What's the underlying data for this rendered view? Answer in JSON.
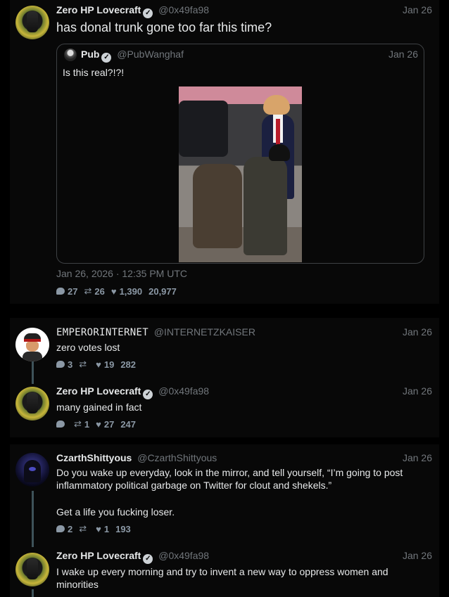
{
  "colors": {
    "background": "#000000",
    "card": "#080808",
    "text": "#e7e9ea",
    "muted": "#71767b",
    "thread_line": "#3e5259"
  },
  "main_tweet": {
    "author_name": "Zero HP Lovecraft",
    "handle": "@0x49fa98",
    "date": "Jan 26",
    "text": "has donal trunk gone too far this time?",
    "quote": {
      "author_name": "Pub",
      "handle": "@PubWanghaf",
      "date": "Jan 26",
      "text": "Is this real?!?!"
    },
    "timestamp": "Jan 26, 2026 · 12:35 PM UTC",
    "stats": {
      "replies": "27",
      "retweets": "26",
      "likes": "1,390",
      "views": "20,977"
    }
  },
  "replies": [
    {
      "author_name": "EMPERORINTERNET",
      "handle": "@INTERNETZKAISER",
      "date": "Jan 26",
      "text": "zero votes lost",
      "stats": {
        "replies": "3",
        "retweets": "",
        "likes": "19",
        "views": "282"
      }
    },
    {
      "author_name": "Zero HP Lovecraft",
      "handle": "@0x49fa98",
      "date": "Jan 26",
      "text": "many gained in fact",
      "stats": {
        "replies": "",
        "retweets": "1",
        "likes": "27",
        "views": "247"
      }
    },
    {
      "author_name": "CzarthShittyous",
      "handle": "@CzarthShittyous",
      "date": "Jan 26",
      "text_1": "Do you wake up everyday, look in the mirror, and tell yourself, “I’m going to post inflammatory political garbage on Twitter for clout and shekels.”",
      "text_2": "Get a life you fucking loser.",
      "stats": {
        "replies": "2",
        "retweets": "",
        "likes": "1",
        "views": "193"
      }
    },
    {
      "author_name": "Zero HP Lovecraft",
      "handle": "@0x49fa98",
      "date": "Jan 26",
      "text": "I wake up every morning and try to invent a new way to oppress women and minorities"
    }
  ],
  "icons": {
    "verified": "verified-badge-icon",
    "reply": "reply-bubble-icon",
    "retweet": "retweet-icon",
    "like": "heart-icon"
  }
}
